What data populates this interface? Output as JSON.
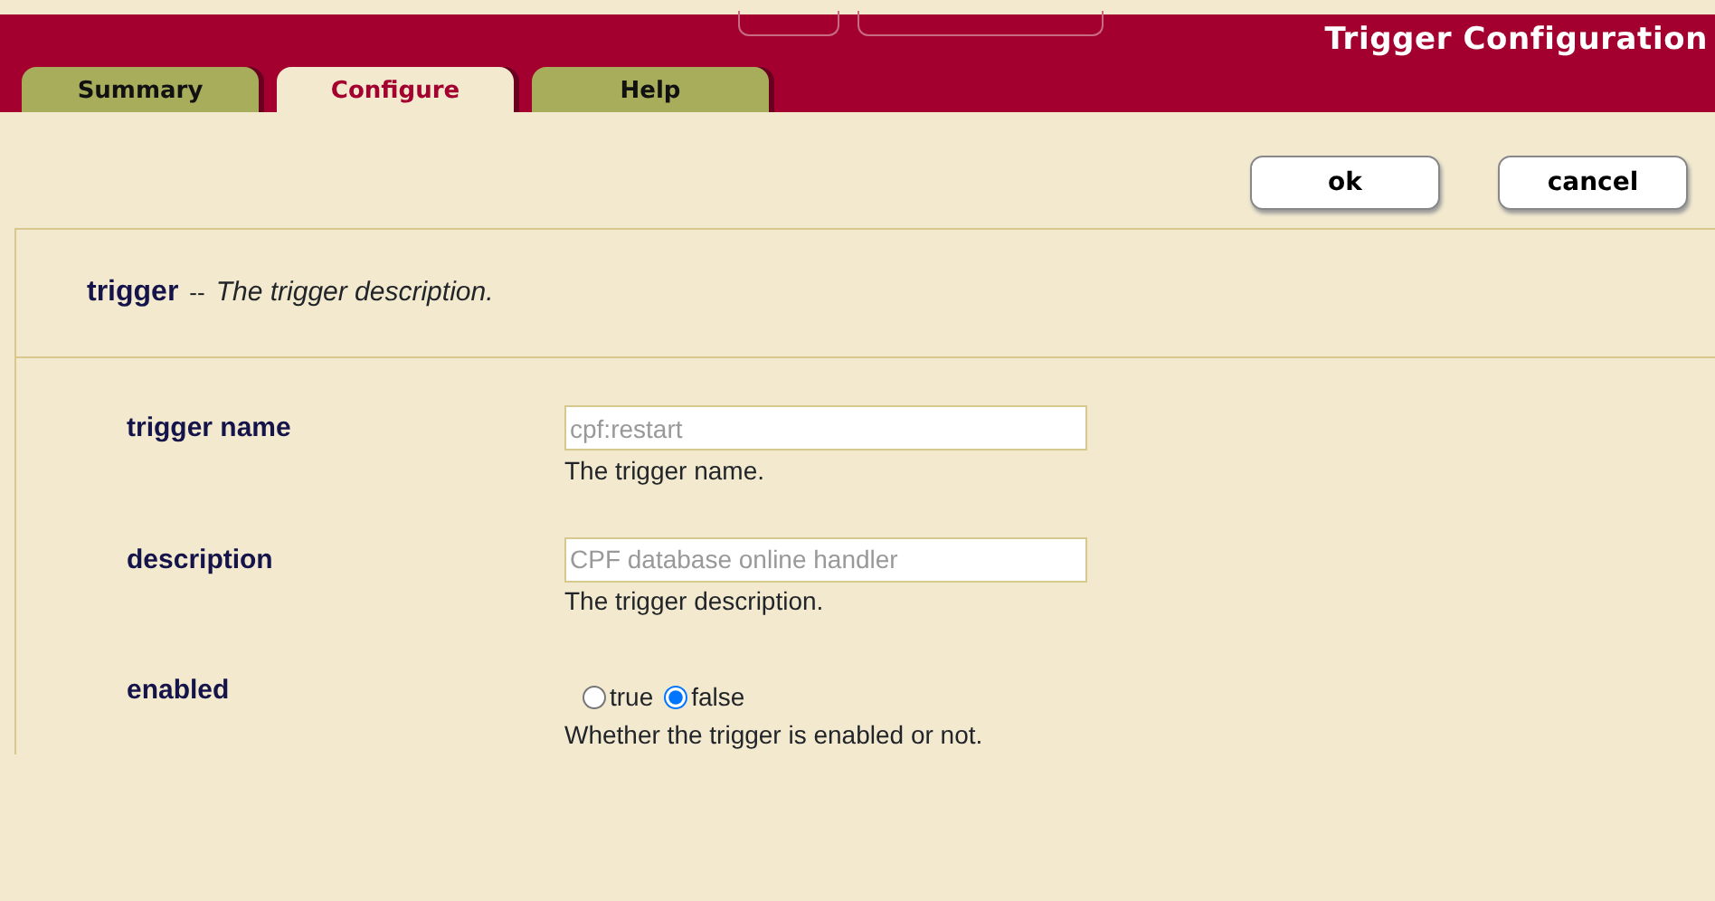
{
  "header": {
    "title": "Trigger Configuration"
  },
  "tabs": [
    {
      "label": "Summary",
      "selected": false
    },
    {
      "label": "Configure",
      "selected": true
    },
    {
      "label": "Help",
      "selected": false
    }
  ],
  "buttons": [
    {
      "label": "ok"
    },
    {
      "label": "cancel"
    }
  ],
  "section": {
    "name": "trigger",
    "separator": "--",
    "description": "The trigger description."
  },
  "fields": [
    {
      "kind": "text",
      "label": "trigger name",
      "value": "cpf:restart",
      "disabled": true,
      "help": "The trigger name."
    },
    {
      "kind": "text",
      "label": "description",
      "value": "CPF database online handler",
      "disabled": true,
      "help": "The trigger description."
    },
    {
      "kind": "radio",
      "label": "enabled",
      "options": [
        {
          "label": "true",
          "selected": false
        },
        {
          "label": "false",
          "selected": true
        }
      ],
      "help": "Whether the trigger is enabled or not."
    }
  ]
}
